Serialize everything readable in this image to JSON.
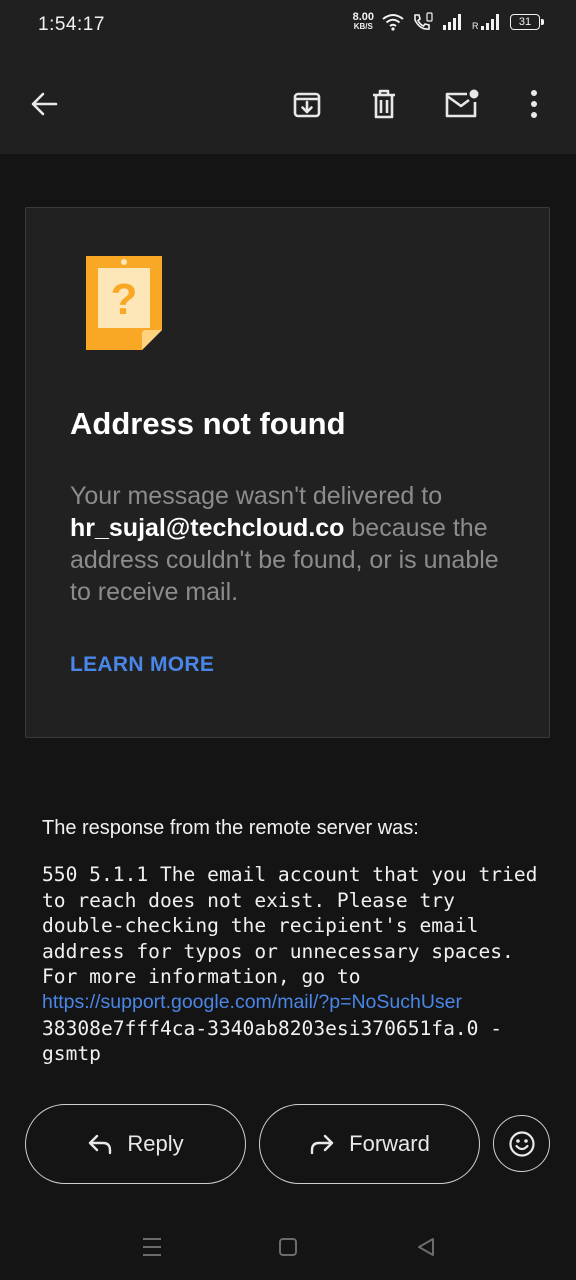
{
  "status": {
    "time": "1:54:17",
    "net_speed_value": "8.00",
    "net_speed_unit": "KB/S",
    "battery": "31"
  },
  "toolbar": {
    "icons": [
      "back-arrow-icon",
      "archive-icon",
      "delete-icon",
      "mark-unread-icon",
      "more-vert-icon"
    ]
  },
  "card": {
    "title": "Address not found",
    "text_before": "Your message wasn't delivered to ",
    "address": "hr_sujal@techcloud.co",
    "text_after": " because the address couldn't be found, or is unable to receive mail.",
    "learn_more": "LEARN MORE"
  },
  "response": {
    "heading": "The response from the remote server was:",
    "body": "550 5.1.1 The email account that you tried to reach does not exist. Please try double-checking the recipient's email address for typos or unnecessary spaces. For more information, go to",
    "link": "https://support.google.com/mail/?p=NoSuchUser",
    "trailer": "38308e7fff4ca-3340ab8203esi370651fa.0 - gsmtp"
  },
  "actions": {
    "reply": "Reply",
    "forward": "Forward"
  },
  "colors": {
    "accent": "#4a86e8",
    "warning_icon": "#f9a825"
  }
}
